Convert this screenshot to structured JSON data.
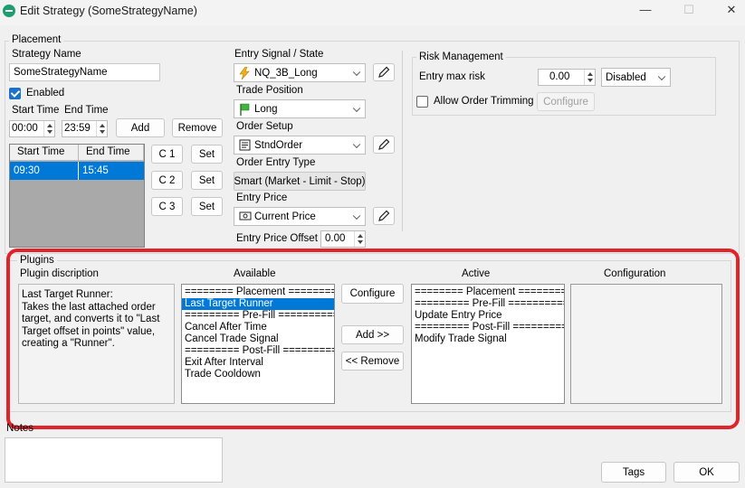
{
  "window": {
    "title": "Edit Strategy (SomeStrategyName)",
    "minimize_glyph": "—",
    "maximize_glyph": "☐",
    "close_glyph": "✕"
  },
  "placement": {
    "group_label": "Placement",
    "strategy_name_label": "Strategy Name",
    "strategy_name_value": "SomeStrategyName",
    "enabled_label": "Enabled",
    "enabled_checked": true,
    "start_time_label": "Start Time",
    "end_time_label": "End Time",
    "start_time_value": "00:00",
    "end_time_value": "23:59",
    "add_label": "Add",
    "remove_label": "Remove",
    "grid_headers": [
      "Start Time",
      "End Time"
    ],
    "grid_rows": [
      [
        "09:30",
        "15:45"
      ]
    ],
    "c_buttons": [
      "C 1",
      "C 2",
      "C 3"
    ],
    "set_label": "Set",
    "entry_signal_label": "Entry Signal / State",
    "entry_signal_value": "NQ_3B_Long",
    "trade_position_label": "Trade Position",
    "trade_position_value": "Long",
    "order_setup_label": "Order Setup",
    "order_setup_value": "StndOrder",
    "order_entry_type_label": "Order Entry Type",
    "order_entry_type_value": "Smart (Market - Limit - Stop)",
    "entry_price_label": "Entry Price",
    "entry_price_value": "Current Price",
    "entry_price_offset_label": "Entry Price Offset",
    "entry_price_offset_value": "0.00"
  },
  "risk": {
    "group_label": "Risk Management",
    "entry_max_risk_label": "Entry max risk",
    "entry_max_risk_value": "0.00",
    "risk_mode_value": "Disabled",
    "allow_trimming_label": "Allow Order Trimming",
    "allow_trimming_checked": false,
    "configure_label": "Configure"
  },
  "plugins": {
    "group_label": "Plugins",
    "description_header": "Plugin discription",
    "description_text": "Last Target Runner:\nTakes the last attached order target, and converts it to \"Last Target offset in points\" value, creating a \"Runner\".",
    "available_header": "Available",
    "available_items": [
      "======== Placement ========",
      "Last Target Runner",
      "========= Pre-Fill ==========",
      "Cancel After Time",
      "Cancel Trade Signal",
      "========= Post-Fill =========",
      "Exit After Interval",
      "Trade Cooldown"
    ],
    "available_selected_index": 1,
    "active_header": "Active",
    "active_items": [
      "======== Placement ========",
      "========= Pre-Fill ==========",
      "Update Entry Price",
      "========= Post-Fill =========",
      "Modify Trade Signal"
    ],
    "configuration_header": "Configuration",
    "configure_label": "Configure",
    "add_label": "Add >>",
    "remove_label": "<< Remove"
  },
  "notes": {
    "label": "Notes",
    "value": ""
  },
  "footer": {
    "tags_label": "Tags",
    "ok_label": "OK"
  },
  "colors": {
    "selection": "#0078d7",
    "highlight_annotation": "#e0242a",
    "app_icon": "#1e9e6e"
  },
  "icons": {
    "entry_signal": "lightning-bolt-icon",
    "trade_position": "green-flag-icon",
    "order_setup": "order-ticket-icon",
    "entry_price": "price-tag-icon",
    "edit": "pencil-icon"
  }
}
